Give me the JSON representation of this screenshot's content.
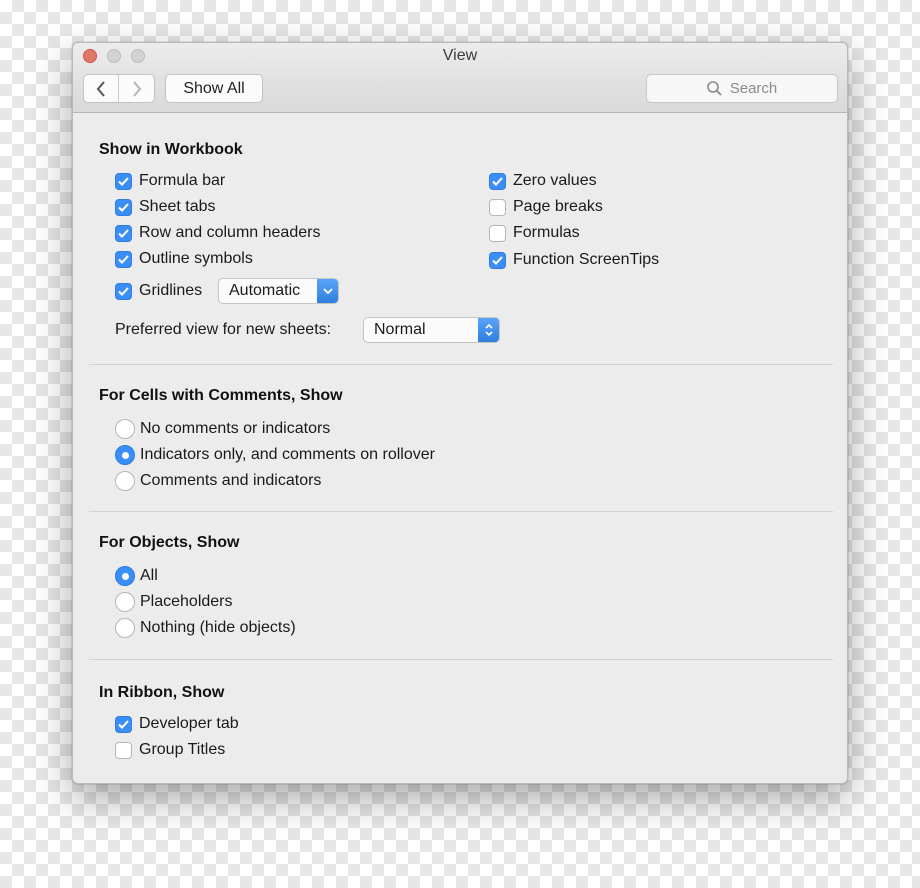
{
  "window": {
    "title": "View"
  },
  "toolbar": {
    "show_all_label": "Show All",
    "search_placeholder": "Search"
  },
  "workbook": {
    "title": "Show in Workbook",
    "left": [
      {
        "label": "Formula bar",
        "checked": true
      },
      {
        "label": "Sheet tabs",
        "checked": true
      },
      {
        "label": "Row and column headers",
        "checked": true
      },
      {
        "label": "Outline symbols",
        "checked": true
      }
    ],
    "right": [
      {
        "label": "Zero values",
        "checked": true
      },
      {
        "label": "Page breaks",
        "checked": false
      },
      {
        "label": "Formulas",
        "checked": false
      },
      {
        "label": "Function ScreenTips",
        "checked": true
      }
    ],
    "gridlines": {
      "label": "Gridlines",
      "checked": true,
      "color_value": "Automatic"
    },
    "preferred_view": {
      "label": "Preferred view for new sheets:",
      "value": "Normal"
    }
  },
  "comments": {
    "title": "For Cells with Comments, Show",
    "options": [
      {
        "label": "No comments or indicators",
        "selected": false
      },
      {
        "label": "Indicators only, and comments on rollover",
        "selected": true
      },
      {
        "label": "Comments and indicators",
        "selected": false
      }
    ]
  },
  "objects": {
    "title": "For Objects, Show",
    "options": [
      {
        "label": "All",
        "selected": true
      },
      {
        "label": "Placeholders",
        "selected": false
      },
      {
        "label": "Nothing (hide objects)",
        "selected": false
      }
    ]
  },
  "ribbon": {
    "title": "In Ribbon, Show",
    "items": [
      {
        "label": "Developer tab",
        "checked": true
      },
      {
        "label": "Group Titles",
        "checked": false
      }
    ]
  },
  "colors": {
    "accent": "#3a8ef6",
    "window_bg": "#ececec"
  }
}
